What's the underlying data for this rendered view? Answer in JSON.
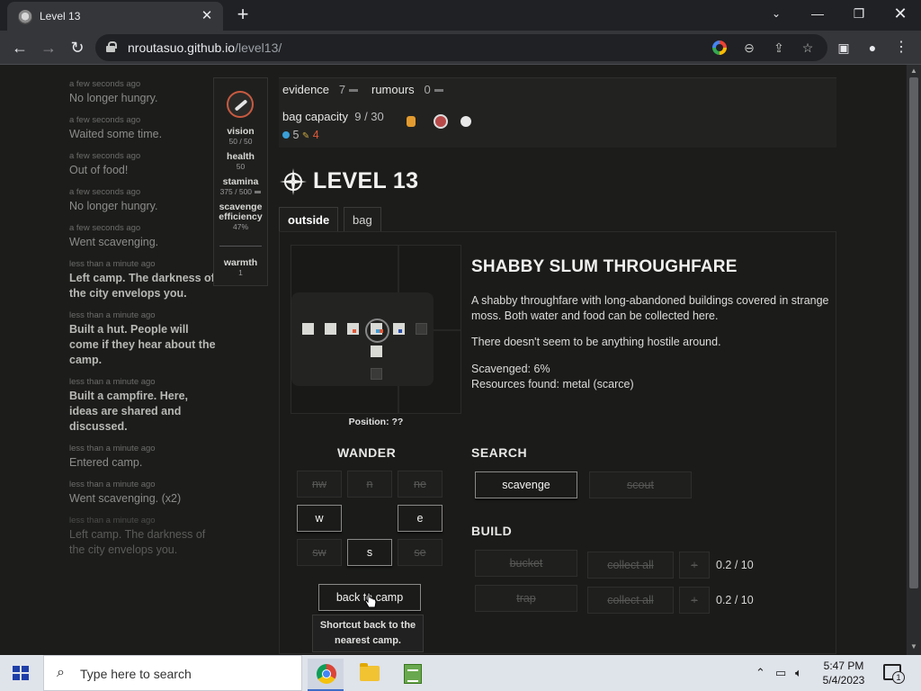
{
  "browser": {
    "tab_title": "Level 13",
    "url_host": "nroutasuo.github.io",
    "url_path": "/level13/"
  },
  "log": [
    {
      "time": "a few seconds ago",
      "text": "No longer hungry.",
      "style": "normal"
    },
    {
      "time": "a few seconds ago",
      "text": "Waited some time.",
      "style": "normal"
    },
    {
      "time": "a few seconds ago",
      "text": "Out of food!",
      "style": "normal"
    },
    {
      "time": "a few seconds ago",
      "text": "No longer hungry.",
      "style": "normal"
    },
    {
      "time": "a few seconds ago",
      "text": "Went scavenging.",
      "style": "normal"
    },
    {
      "time": "less than a minute ago",
      "text": "Left camp. The darkness of the city envelops you.",
      "style": "fresh"
    },
    {
      "time": "less than a minute ago",
      "text": "Built a hut. People will come if they hear about the camp.",
      "style": "fresh"
    },
    {
      "time": "less than a minute ago",
      "text": "Built a campfire. Here, ideas are shared and discussed.",
      "style": "fresh"
    },
    {
      "time": "less than a minute ago",
      "text": "Entered camp.",
      "style": "normal"
    },
    {
      "time": "less than a minute ago",
      "text": "Went scavenging. (x2)",
      "style": "normal"
    },
    {
      "time": "less than a minute ago",
      "text": "Left camp. The darkness of the city envelops you.",
      "style": "faded"
    }
  ],
  "status": {
    "vision_label": "vision",
    "vision_value": "50 / 50",
    "health_label": "health",
    "health_value": "50",
    "stamina_label": "stamina",
    "stamina_value": "375 / 500",
    "scavenge_label": "scavenge efficiency",
    "scavenge_value": "47%",
    "warmth_label": "warmth",
    "warmth_value": "1"
  },
  "resources": {
    "evidence_label": "evidence",
    "evidence_value": "7",
    "rumours_label": "rumours",
    "rumours_value": "0",
    "bag_label": "bag capacity",
    "bag_value": "9 / 30",
    "water_value": "5",
    "metal_value": "4",
    "water_color": "#3aa0d8",
    "metal_color": "#e05a3a"
  },
  "header": {
    "title": "LEVEL 13"
  },
  "tabs": {
    "outside": "outside",
    "bag": "bag"
  },
  "map": {
    "position_label": "Position: ??"
  },
  "location": {
    "title": "SHABBY SLUM THROUGHFARE",
    "description": "A shabby throughfare with long-abandoned buildings covered in strange moss. Both water and food can be collected here.",
    "hostile": "There doesn't seem to be anything hostile around.",
    "scavenged": "Scavenged: 6%",
    "resources_found": "Resources found: metal (scarce)"
  },
  "wander": {
    "title": "WANDER",
    "nw": "nw",
    "n": "n",
    "ne": "ne",
    "w": "w",
    "e": "e",
    "sw": "sw",
    "s": "s",
    "se": "se",
    "back": "back to camp",
    "tooltip": "Shortcut back to the nearest camp."
  },
  "search": {
    "title": "SEARCH",
    "scavenge": "scavenge",
    "scout": "scout"
  },
  "build": {
    "title": "BUILD",
    "bucket": "bucket",
    "bucket_collect": "collect all",
    "bucket_value": "0.2 / 10",
    "trap": "trap",
    "trap_collect": "collect all",
    "trap_value": "0.2 / 10",
    "plus": "+"
  },
  "taskbar": {
    "search_placeholder": "Type here to search",
    "time": "5:47 PM",
    "date": "5/4/2023",
    "notifications": "1"
  }
}
